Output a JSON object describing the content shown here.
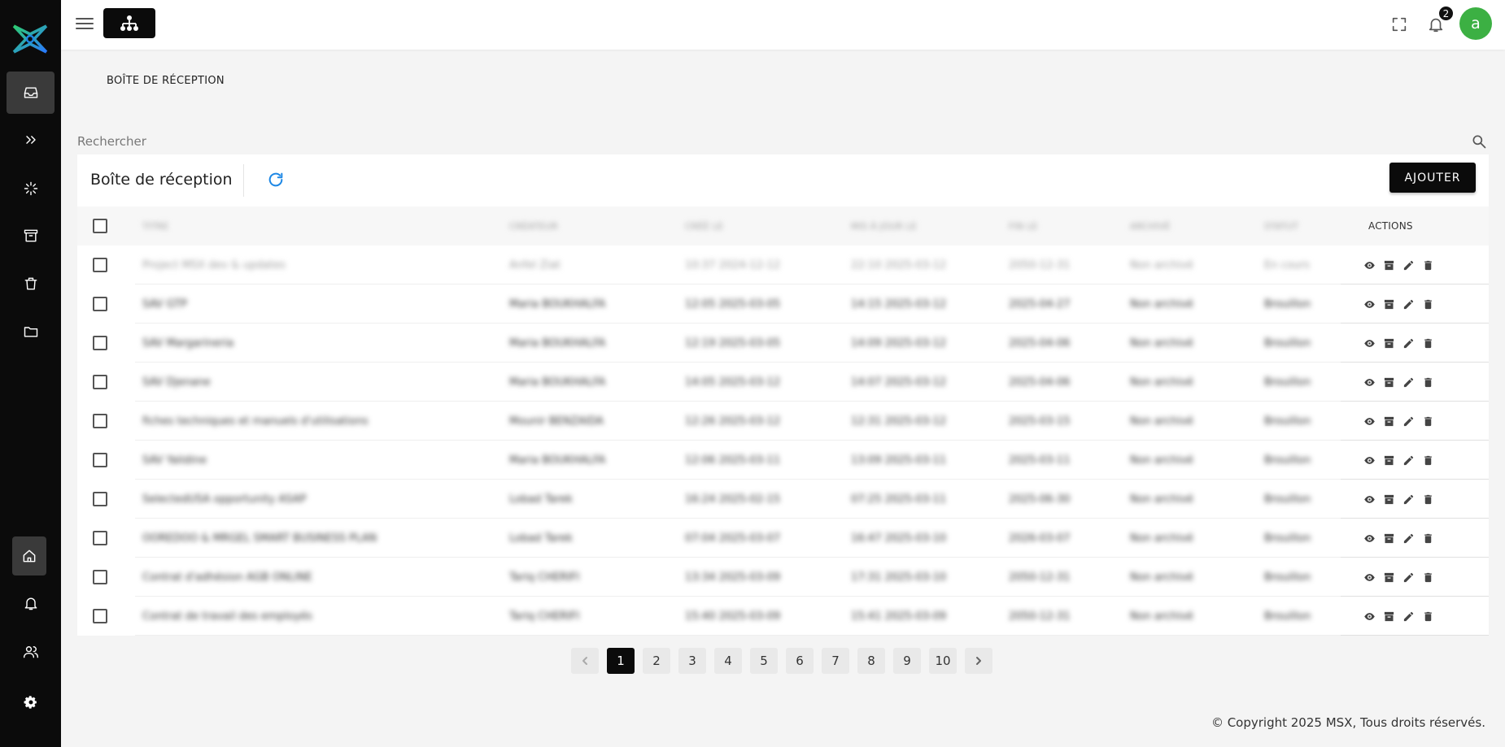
{
  "topbar": {
    "notification_count": "2",
    "avatar_initial": "a"
  },
  "breadcrumb": "BOÎTE DE RÉCEPTION",
  "search": {
    "placeholder": "Rechercher"
  },
  "card": {
    "title": "Boîte de réception",
    "add_label": "AJOUTER"
  },
  "table": {
    "headers": [
      "TITRE",
      "CRÉATEUR",
      "CRÉÉ LE",
      "MIS À JOUR LE",
      "FIN LE",
      "ARCHIVÉ",
      "STATUT",
      "ACTIONS"
    ],
    "rows": [
      [
        "Project MSX dev & updates",
        "Anfel Ziat",
        "10:37 2024-12-12",
        "22:10 2025-03-12",
        "2050-12-31",
        "Non archivé",
        "En cours"
      ],
      [
        "SAV GTP",
        "Maria BOUKHALFA",
        "12:05 2025-03-05",
        "14:15 2025-03-12",
        "2025-04-27",
        "Non archivé",
        "Brouillon"
      ],
      [
        "SAV Margarineria",
        "Maria BOUKHALFA",
        "12:19 2025-03-05",
        "14:09 2025-03-12",
        "2025-04-06",
        "Non archivé",
        "Brouillon"
      ],
      [
        "SAV Djenane",
        "Maria BOUKHALFA",
        "14:05 2025-03-12",
        "14:07 2025-03-12",
        "2025-04-06",
        "Non archivé",
        "Brouillon"
      ],
      [
        "fiches techniques et manuels d'utilisations",
        "Mounir BENZAIDA",
        "12:26 2025-03-12",
        "12:31 2025-03-12",
        "2025-03-15",
        "Non archivé",
        "Brouillon"
      ],
      [
        "SAV Yalidine",
        "Maria BOUKHALFA",
        "12:06 2025-03-11",
        "13:09 2025-03-11",
        "2025-03-11",
        "Non archivé",
        "Brouillon"
      ],
      [
        "SelectedUSA opportunity ASAP",
        "Lobad Tarek",
        "16:24 2025-02-15",
        "07:25 2025-03-11",
        "2025-06-30",
        "Non archivé",
        "Brouillon"
      ],
      [
        "OOREDOO & MRGEL SMART BUSINESS PLAN",
        "Lobad Tarek",
        "07:04 2025-03-07",
        "16:47 2025-03-10",
        "2026-03-07",
        "Non archivé",
        "Brouillon"
      ],
      [
        "Contrat d'adhésion AGB ONLINE",
        "Tariq CHERIFI",
        "13:34 2025-03-09",
        "17:31 2025-03-10",
        "2050-12-31",
        "Non archivé",
        "Brouillon"
      ],
      [
        "Contrat de travail des employés",
        "Tariq CHERIFI",
        "15:40 2025-03-09",
        "15:41 2025-03-09",
        "2050-12-31",
        "Non archivé",
        "Brouillon"
      ]
    ]
  },
  "pagination": {
    "pages": [
      "1",
      "2",
      "3",
      "4",
      "5",
      "6",
      "7",
      "8",
      "9",
      "10"
    ],
    "current": "1"
  },
  "footer": "© Copyright 2025 MSX, Tous droits réservés.",
  "colors": {
    "sidebar_bg": "#0b0b0b",
    "accent_refresh": "#1e88e5",
    "avatar_bg": "#3cb043",
    "primary_button": "#0b0b0b"
  }
}
